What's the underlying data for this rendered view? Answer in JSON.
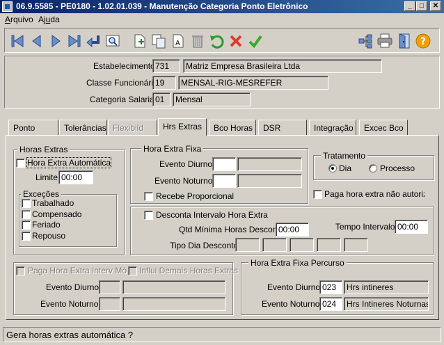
{
  "window": {
    "title": "06.9.5585 - PE0180 - 1.02.01.039 - Manutenção Categoria Ponto Eletrônico",
    "minimize": "_",
    "maximize": "□",
    "close": "✕"
  },
  "menu": {
    "arquivo_first": "A",
    "arquivo_rest": "rquivo",
    "ajuda_first": "Aj",
    "ajuda_u": "u",
    "ajuda_rest": "da"
  },
  "header": {
    "estabelecimento_label": "Estabelecimento:",
    "estabelecimento_code": "731",
    "estabelecimento_name": "Matriz Empresa Brasileira Ltda",
    "classe_label": "Classe Funcionário:",
    "classe_code": "19",
    "classe_name": "MENSAL-RIG-MESREFER",
    "categoria_label": "Categoria Salarial:",
    "categoria_code": "01",
    "categoria_name": "Mensal"
  },
  "tabs": [
    {
      "label": "Ponto"
    },
    {
      "label": "Tolerâncias"
    },
    {
      "label": "Flexibild"
    },
    {
      "label": "Hrs Extras"
    },
    {
      "label": "Bco Horas"
    },
    {
      "label": "DSR"
    },
    {
      "label": "Integração"
    },
    {
      "label": "Excec Bco"
    }
  ],
  "horas_extras": {
    "title": "Horas Extras",
    "automatica_label": "Hora Extra Automática",
    "limite_label": "Limite:",
    "limite_value": "00:00",
    "excecoes_title": "Exceções",
    "trabalhado": "Trabalhado",
    "compensado": "Compensado",
    "feriado": "Feriado",
    "repouso": "Repouso"
  },
  "hora_extra_fixa": {
    "title": "Hora Extra Fixa",
    "evento_diurno_label": "Evento Diurno:",
    "evento_noturno_label": "Evento Noturno:",
    "recebe_proporcional": "Recebe Proporcional"
  },
  "tratamento": {
    "title": "Tratamento",
    "dia": "Dia",
    "processo": "Processo",
    "paga_nao_autorizada": "Paga hora extra não autorizada"
  },
  "intervalo": {
    "desconta_label": "Desconta Intervalo Hora Extra",
    "qtd_label": "Qtd Mínima Horas Desconto:",
    "qtd_value": "00:00",
    "tempo_label": "Tempo Intervalo:",
    "tempo_value": "00:00",
    "tipo_dia_label": "Tipo Dia Desconto:"
  },
  "interv_movel": {
    "paga_label": "Paga Hora Extra Interv Móvel",
    "influi_label": "Influi Demais Horas Extras",
    "evento_diurno_label": "Evento Diurno:",
    "evento_noturno_label": "Evento Noturno:"
  },
  "percurso": {
    "title": "Hora Extra Fixa Percurso",
    "evento_diurno_label": "Evento Diurno:",
    "evento_diurno_code": "023",
    "evento_diurno_desc": "Hrs intineres",
    "evento_noturno_label": "Evento Noturno:",
    "evento_noturno_code": "024",
    "evento_noturno_desc": "Hrs Intineres Noturnas"
  },
  "status": {
    "text": "Gera horas extras automática ?"
  }
}
